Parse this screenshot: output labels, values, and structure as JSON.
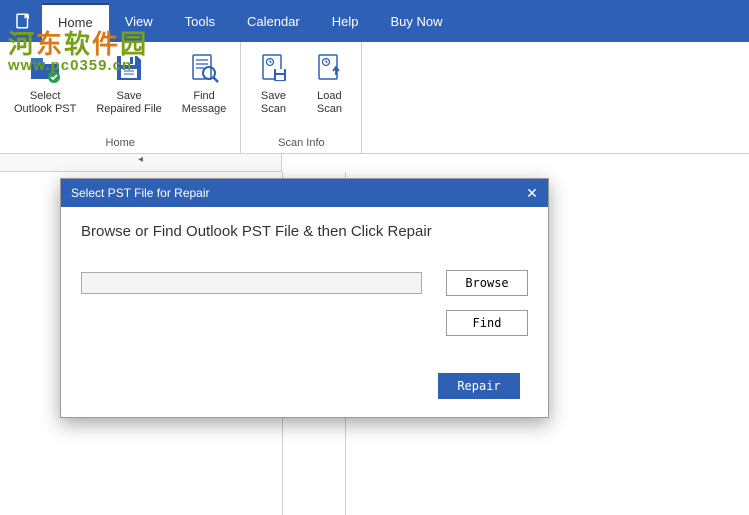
{
  "watermark": {
    "line1_chars": "河东软件园",
    "line2": "www.pc0359.cn"
  },
  "menu": {
    "items": [
      "Home",
      "View",
      "Tools",
      "Calendar",
      "Help",
      "Buy Now"
    ],
    "active_index": 0
  },
  "ribbon": {
    "group_home": {
      "label": "Home",
      "buttons": [
        {
          "label": "Select\nOutlook PST",
          "icon": "folder-check"
        },
        {
          "label": "Save\nRepaired File",
          "icon": "floppy-save"
        },
        {
          "label": "Find\nMessage",
          "icon": "magnify-doc"
        }
      ]
    },
    "group_scan": {
      "label": "Scan Info",
      "buttons": [
        {
          "label": "Save\nScan",
          "icon": "page-save"
        },
        {
          "label": "Load\nScan",
          "icon": "page-load"
        }
      ]
    }
  },
  "dialog": {
    "title": "Select PST File for Repair",
    "heading": "Browse or Find Outlook PST File & then Click Repair",
    "path_value": "",
    "browse_label": "Browse",
    "find_label": "Find",
    "repair_label": "Repair"
  }
}
